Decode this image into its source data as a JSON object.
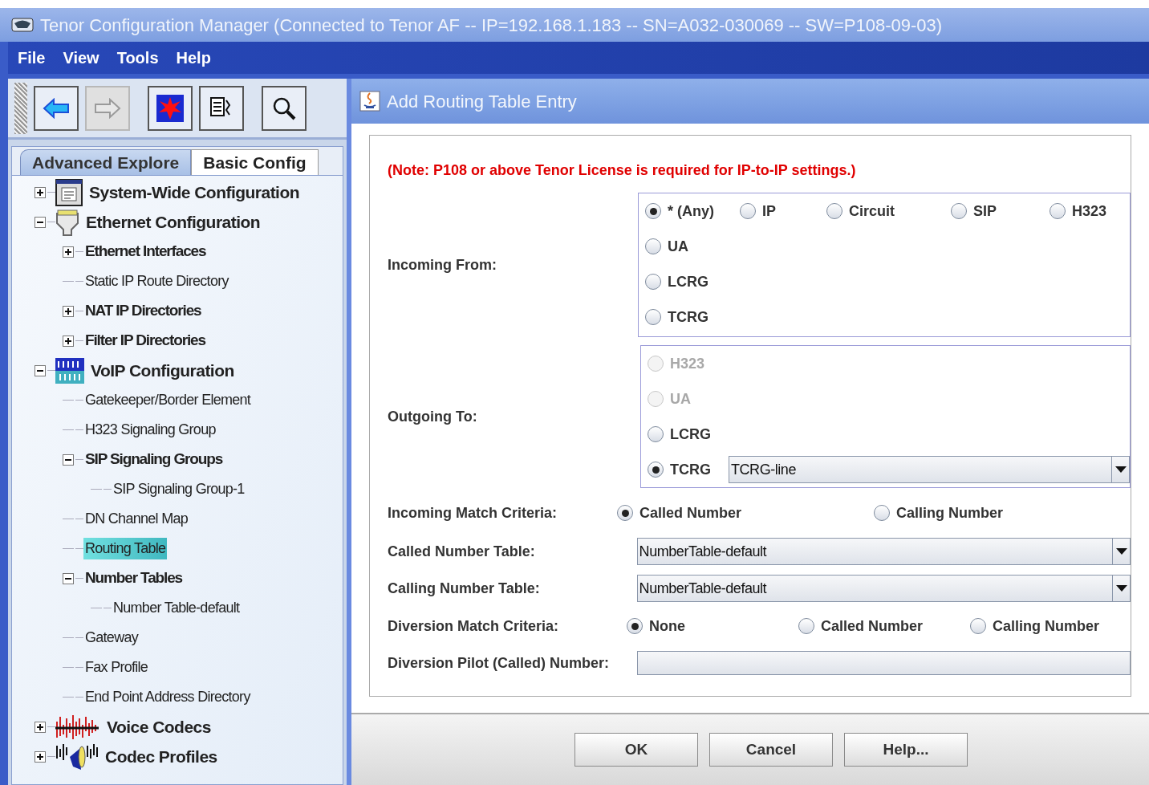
{
  "window": {
    "title": "Tenor Configuration Manager (Connected to Tenor AF -- IP=192.168.1.183 -- SN=A032-030069 -- SW=P108-09-03)"
  },
  "menu": [
    "File",
    "View",
    "Tools",
    "Help"
  ],
  "toolbar": [
    {
      "kind": "back",
      "disabled": false
    },
    {
      "kind": "forward",
      "disabled": true
    },
    {
      "kind": "star",
      "disabled": false
    },
    {
      "kind": "form",
      "disabled": false
    },
    {
      "kind": "search",
      "disabled": false
    }
  ],
  "tabs": [
    {
      "label": "Advanced Explore",
      "selected": true
    },
    {
      "label": "Basic Config",
      "selected": false
    }
  ],
  "tree": [
    {
      "label": "System-Wide Configuration",
      "kind": "system",
      "expanded": false,
      "selected": false
    },
    {
      "label": "Ethernet Configuration",
      "kind": "ethernet",
      "expanded": true,
      "selected": false,
      "children": [
        {
          "label": "Ethernet Interfaces",
          "expanded": false,
          "selected": false
        },
        {
          "label": "Static IP Route Directory",
          "selected": false
        },
        {
          "label": "NAT IP Directories",
          "expanded": false,
          "selected": false
        },
        {
          "label": "Filter IP Directories",
          "expanded": false,
          "selected": false
        }
      ]
    },
    {
      "label": "VoIP Configuration",
      "kind": "voip",
      "expanded": true,
      "selected": false,
      "children": [
        {
          "label": "Gatekeeper/Border Element",
          "selected": false
        },
        {
          "label": "H323 Signaling Group",
          "selected": false
        },
        {
          "label": "SIP Signaling Groups",
          "expanded": true,
          "selected": false,
          "children": [
            {
              "label": "SIP Signaling Group-1",
              "selected": false
            }
          ]
        },
        {
          "label": "DN Channel Map",
          "selected": false
        },
        {
          "label": "Routing Table",
          "selected": true
        },
        {
          "label": "Number Tables",
          "expanded": true,
          "selected": false,
          "children": [
            {
              "label": "Number Table-default",
              "selected": false
            }
          ]
        },
        {
          "label": "Gateway",
          "selected": false
        },
        {
          "label": "Fax Profile",
          "selected": false
        },
        {
          "label": "End Point Address Directory",
          "selected": false
        }
      ]
    },
    {
      "label": "Voice Codecs",
      "kind": "voice",
      "expanded": false,
      "selected": false
    },
    {
      "label": "Codec Profiles",
      "kind": "codec",
      "expanded": false,
      "selected": false
    }
  ],
  "dialog": {
    "title": "Add Routing Table Entry",
    "note": "(Note: P108 or above Tenor License is required for IP-to-IP settings.)",
    "incoming_from": {
      "label": "Incoming From:",
      "options": [
        {
          "label": "* (Any)",
          "selected": true,
          "disabled": false
        },
        {
          "label": "IP",
          "selected": false,
          "disabled": false
        },
        {
          "label": "Circuit",
          "selected": false,
          "disabled": false
        },
        {
          "label": "SIP",
          "selected": false,
          "disabled": false
        },
        {
          "label": "H323",
          "selected": false,
          "disabled": false
        },
        {
          "label": "UA",
          "selected": false,
          "disabled": false
        },
        {
          "label": "LCRG",
          "selected": false,
          "disabled": false
        },
        {
          "label": "TCRG",
          "selected": false,
          "disabled": false
        }
      ]
    },
    "outgoing_to": {
      "label": "Outgoing To:",
      "options": [
        {
          "label": "H323",
          "selected": false,
          "disabled": true
        },
        {
          "label": "UA",
          "selected": false,
          "disabled": true
        },
        {
          "label": "LCRG",
          "selected": false,
          "disabled": false
        },
        {
          "label": "TCRG",
          "selected": true,
          "disabled": false,
          "dropdown": "TCRG-line"
        }
      ]
    },
    "incoming_match": {
      "label": "Incoming Match Criteria:",
      "options": [
        {
          "label": "Called Number",
          "selected": true
        },
        {
          "label": "Calling Number",
          "selected": false
        }
      ]
    },
    "called_table": {
      "label": "Called Number Table:",
      "value": "NumberTable-default"
    },
    "calling_table": {
      "label": "Calling Number Table:",
      "value": "NumberTable-default"
    },
    "diversion_match": {
      "label": "Diversion Match Criteria:",
      "options": [
        {
          "label": "None",
          "selected": true
        },
        {
          "label": "Called Number",
          "selected": false
        },
        {
          "label": "Calling Number",
          "selected": false
        }
      ]
    },
    "diversion_pilot": {
      "label": "Diversion Pilot (Called) Number:"
    },
    "buttons": [
      "OK",
      "Cancel",
      "Help..."
    ]
  }
}
